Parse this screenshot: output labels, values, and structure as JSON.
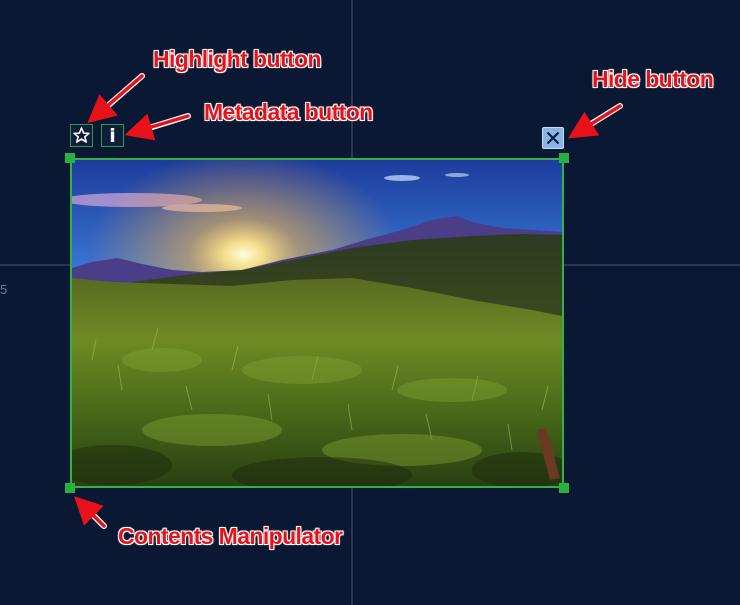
{
  "canvas": {
    "axis_tick_label": "5"
  },
  "content_item": {
    "image_description_icon": "landscape-photo",
    "toolbar": {
      "highlight_icon": "star-icon",
      "metadata_icon_glyph": "i"
    },
    "hide_icon": "close-icon"
  },
  "annotations": {
    "highlight": "Highlight button",
    "metadata": "Metadata button",
    "hide": "Hide button",
    "contents": "Contents Manipulator"
  },
  "colors": {
    "background": "#0b1833",
    "frame_border": "#2fb24a",
    "annotation_text": "#e8121b",
    "hide_button": "#8ab3e6"
  }
}
